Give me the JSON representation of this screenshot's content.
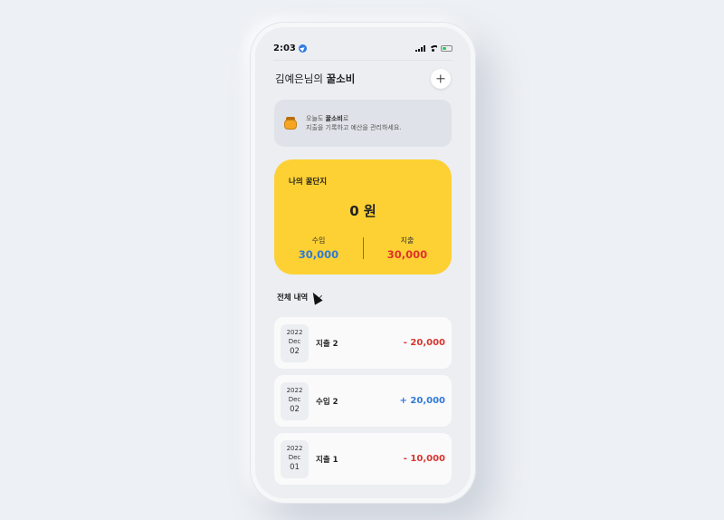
{
  "status": {
    "time": "2:03"
  },
  "header": {
    "prefix": "김예은님의 ",
    "brand": "꿀소비"
  },
  "banner": {
    "line1_prefix": "오늘도 ",
    "line1_bold": "꿀소비",
    "line1_suffix": "로",
    "line2": "지출을 기록하고 예산을 관리하세요."
  },
  "card": {
    "title": "나의 꿀단지",
    "total": "0 원",
    "income_label": "수입",
    "income_value": "30,000",
    "expense_label": "지출",
    "expense_value": "30,000",
    "color": "#fdd133"
  },
  "section": {
    "title": "전체 내역"
  },
  "transactions": [
    {
      "year": "2022",
      "month": "Dec",
      "day": "02",
      "name": "지출 2",
      "amount": "- 20,000"
    },
    {
      "year": "2022",
      "month": "Dec",
      "day": "02",
      "name": "수입 2",
      "amount": "+ 20,000"
    },
    {
      "year": "2022",
      "month": "Dec",
      "day": "01",
      "name": "지출 1",
      "amount": "- 10,000"
    }
  ],
  "colors": {
    "income": "#2f7ad6",
    "expense": "#e0322b"
  }
}
